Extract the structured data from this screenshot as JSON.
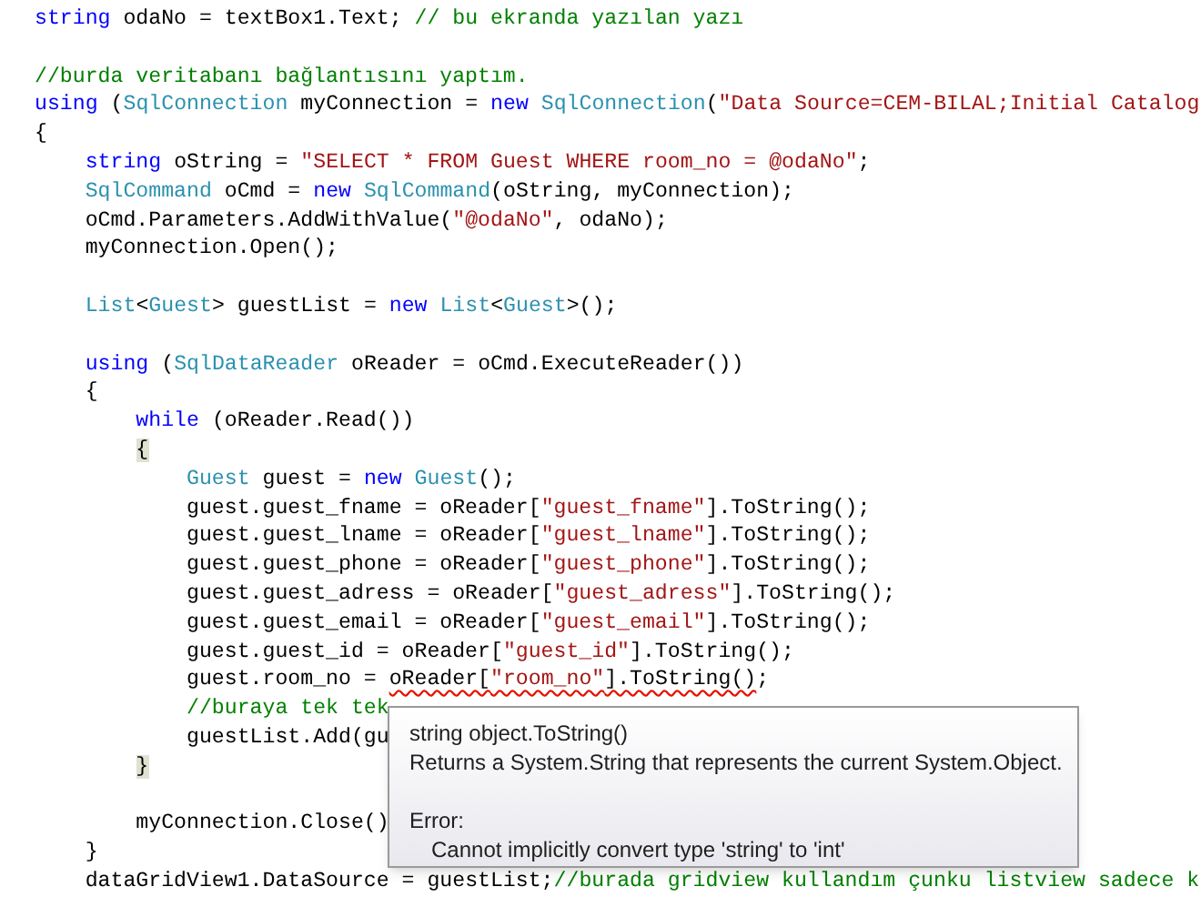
{
  "code_lines": [
    {
      "kind": "code",
      "tokens": [
        {
          "kind": "keyword",
          "text": "string"
        },
        {
          "kind": "plain",
          "text": " odaNo = textBox1.Text; "
        },
        {
          "kind": "comment",
          "text": "// bu ekranda yazılan yazı"
        }
      ]
    },
    {
      "kind": "blank"
    },
    {
      "kind": "code",
      "tokens": [
        {
          "kind": "comment",
          "text": "//burda veritabanı bağlantısını yaptım."
        }
      ]
    },
    {
      "kind": "code",
      "tokens": [
        {
          "kind": "keyword",
          "text": "using"
        },
        {
          "kind": "plain",
          "text": " ("
        },
        {
          "kind": "type",
          "text": "SqlConnection"
        },
        {
          "kind": "plain",
          "text": " myConnection = "
        },
        {
          "kind": "keyword",
          "text": "new "
        },
        {
          "kind": "type",
          "text": "SqlConnection"
        },
        {
          "kind": "plain",
          "text": "("
        },
        {
          "kind": "string",
          "text": "\"Data Source=CEM-BILAL;Initial Catalog"
        }
      ]
    },
    {
      "kind": "code",
      "tokens": [
        {
          "kind": "plain",
          "text": "{"
        }
      ]
    },
    {
      "kind": "code",
      "tokens": [
        {
          "kind": "keyword",
          "text": "    string"
        },
        {
          "kind": "plain",
          "text": " oString = "
        },
        {
          "kind": "string",
          "text": "\"SELECT * FROM Guest WHERE room_no = @odaNo\""
        },
        {
          "kind": "plain",
          "text": ";"
        }
      ]
    },
    {
      "kind": "code",
      "tokens": [
        {
          "kind": "type",
          "text": "    SqlCommand"
        },
        {
          "kind": "plain",
          "text": " oCmd = "
        },
        {
          "kind": "keyword",
          "text": "new "
        },
        {
          "kind": "type",
          "text": "SqlCommand"
        },
        {
          "kind": "plain",
          "text": "(oString, myConnection);"
        }
      ]
    },
    {
      "kind": "code",
      "tokens": [
        {
          "kind": "plain",
          "text": "    oCmd.Parameters.AddWithValue("
        },
        {
          "kind": "string",
          "text": "\"@odaNo\""
        },
        {
          "kind": "plain",
          "text": ", odaNo);"
        }
      ]
    },
    {
      "kind": "code",
      "tokens": [
        {
          "kind": "plain",
          "text": "    myConnection.Open();"
        }
      ]
    },
    {
      "kind": "blank"
    },
    {
      "kind": "code",
      "tokens": [
        {
          "kind": "type",
          "text": "    List"
        },
        {
          "kind": "plain",
          "text": "<"
        },
        {
          "kind": "type",
          "text": "Guest"
        },
        {
          "kind": "plain",
          "text": "> guestList = "
        },
        {
          "kind": "keyword",
          "text": "new "
        },
        {
          "kind": "type",
          "text": "List"
        },
        {
          "kind": "plain",
          "text": "<"
        },
        {
          "kind": "type",
          "text": "Guest"
        },
        {
          "kind": "plain",
          "text": ">();"
        }
      ]
    },
    {
      "kind": "blank"
    },
    {
      "kind": "code",
      "tokens": [
        {
          "kind": "keyword",
          "text": "    using"
        },
        {
          "kind": "plain",
          "text": " ("
        },
        {
          "kind": "type",
          "text": "SqlDataReader"
        },
        {
          "kind": "plain",
          "text": " oReader = oCmd.ExecuteReader())"
        }
      ]
    },
    {
      "kind": "code",
      "tokens": [
        {
          "kind": "plain",
          "text": "    {"
        }
      ]
    },
    {
      "kind": "code",
      "tokens": [
        {
          "kind": "keyword",
          "text": "        while"
        },
        {
          "kind": "plain",
          "text": " (oReader.Read())"
        }
      ]
    },
    {
      "kind": "code",
      "tokens": [
        {
          "kind": "plain",
          "text": "        {",
          "highlight": true
        }
      ]
    },
    {
      "kind": "code",
      "tokens": [
        {
          "kind": "type",
          "text": "            Guest"
        },
        {
          "kind": "plain",
          "text": " guest = "
        },
        {
          "kind": "keyword",
          "text": "new "
        },
        {
          "kind": "type",
          "text": "Guest"
        },
        {
          "kind": "plain",
          "text": "();"
        }
      ]
    },
    {
      "kind": "code",
      "tokens": [
        {
          "kind": "plain",
          "text": "            guest.guest_fname = oReader["
        },
        {
          "kind": "string",
          "text": "\"guest_fname\""
        },
        {
          "kind": "plain",
          "text": "].ToString();"
        }
      ]
    },
    {
      "kind": "code",
      "tokens": [
        {
          "kind": "plain",
          "text": "            guest.guest_lname = oReader["
        },
        {
          "kind": "string",
          "text": "\"guest_lname\""
        },
        {
          "kind": "plain",
          "text": "].ToString();"
        }
      ]
    },
    {
      "kind": "code",
      "tokens": [
        {
          "kind": "plain",
          "text": "            guest.guest_phone = oReader["
        },
        {
          "kind": "string",
          "text": "\"guest_phone\""
        },
        {
          "kind": "plain",
          "text": "].ToString();"
        }
      ]
    },
    {
      "kind": "code",
      "tokens": [
        {
          "kind": "plain",
          "text": "            guest.guest_adress = oReader["
        },
        {
          "kind": "string",
          "text": "\"guest_adress\""
        },
        {
          "kind": "plain",
          "text": "].ToString();"
        }
      ]
    },
    {
      "kind": "code",
      "tokens": [
        {
          "kind": "plain",
          "text": "            guest.guest_email = oReader["
        },
        {
          "kind": "string",
          "text": "\"guest_email\""
        },
        {
          "kind": "plain",
          "text": "].ToString();"
        }
      ]
    },
    {
      "kind": "code",
      "tokens": [
        {
          "kind": "plain",
          "text": "            guest.guest_id = oReader["
        },
        {
          "kind": "string",
          "text": "\"guest_id\""
        },
        {
          "kind": "plain",
          "text": "].ToString();"
        }
      ]
    },
    {
      "kind": "code",
      "tokens": [
        {
          "kind": "plain",
          "text": "            guest.room_no = "
        },
        {
          "kind": "plain",
          "text": "oReader[",
          "squiggle": true
        },
        {
          "kind": "string",
          "text": "\"room_no\"",
          "squiggle": true
        },
        {
          "kind": "plain",
          "text": "].ToString()",
          "squiggle": true
        },
        {
          "kind": "plain",
          "text": ";"
        }
      ]
    },
    {
      "kind": "code",
      "tokens": [
        {
          "kind": "comment",
          "text": "            //buraya tek tek"
        }
      ]
    },
    {
      "kind": "code",
      "tokens": [
        {
          "kind": "plain",
          "text": "            guestList.Add(gu"
        }
      ]
    },
    {
      "kind": "code",
      "tokens": [
        {
          "kind": "plain",
          "text": "        }",
          "highlight": true
        }
      ]
    },
    {
      "kind": "blank"
    },
    {
      "kind": "code",
      "tokens": [
        {
          "kind": "plain",
          "text": "        myConnection.Close()"
        }
      ]
    },
    {
      "kind": "code",
      "tokens": [
        {
          "kind": "plain",
          "text": "    }"
        }
      ]
    },
    {
      "kind": "code",
      "tokens": [
        {
          "kind": "plain",
          "text": "    dataGridView1.DataSource = guestList;"
        },
        {
          "kind": "comment",
          "text": "//burada gridview kullandım çunku listview sadece k"
        }
      ]
    }
  ],
  "tooltip": {
    "signature": "string object.ToString()",
    "description": "Returns a System.String that represents the current System.Object.",
    "error_label": "Error:",
    "error_message": "Cannot implicitly convert type 'string' to 'int'"
  }
}
